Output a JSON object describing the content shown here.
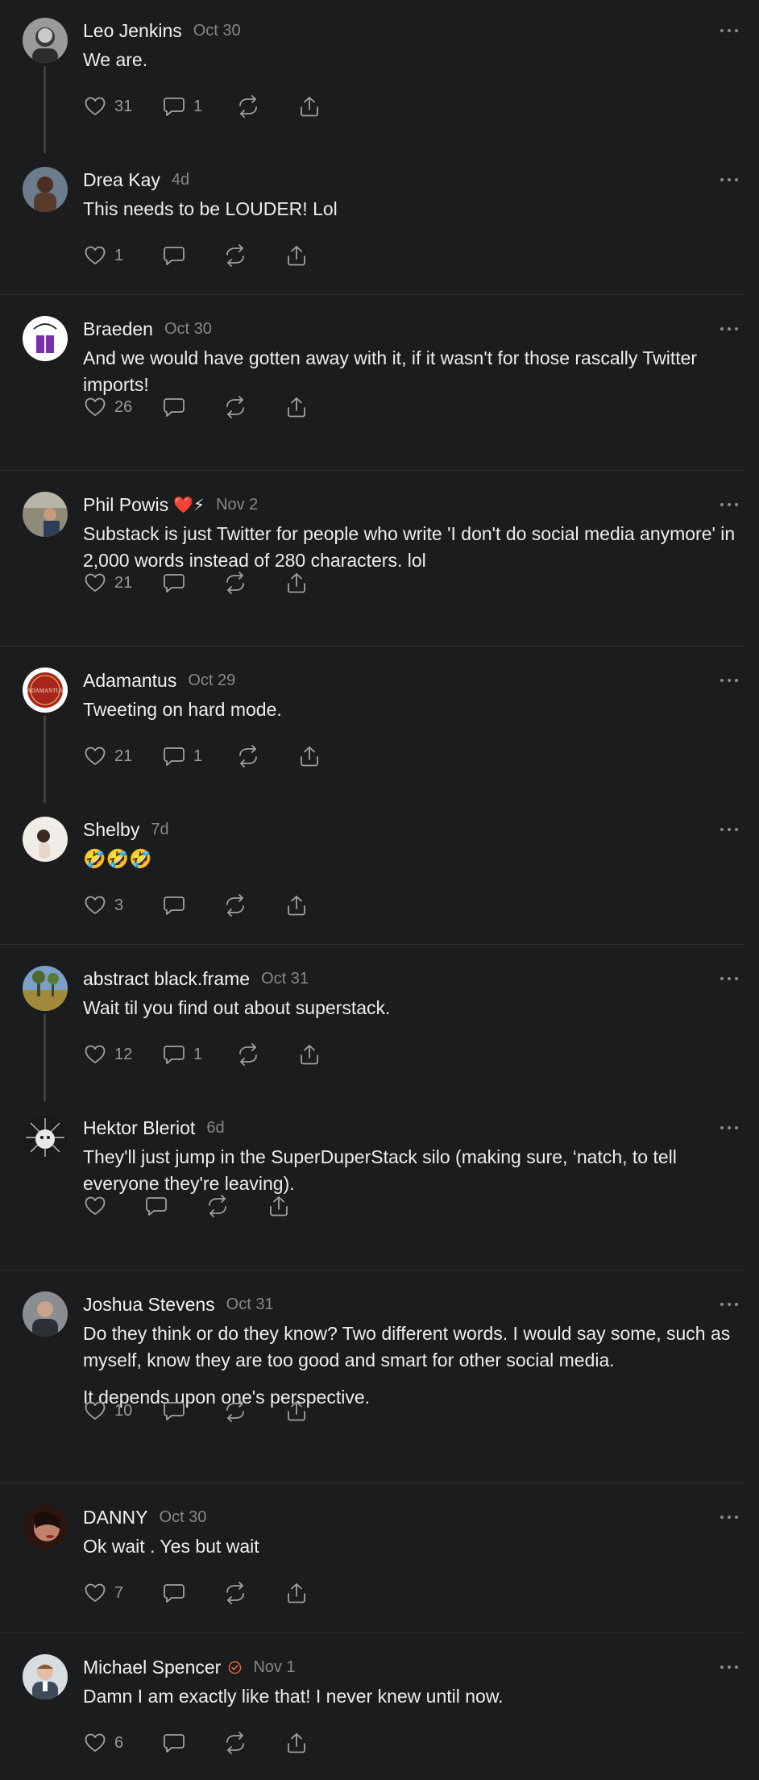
{
  "colors": {
    "background": "#1b1c1e",
    "text": "#ededed",
    "muted": "#86878a",
    "divider": "#2f3033",
    "verified": "#e8643a"
  },
  "comments": [
    {
      "name": "Leo Jenkins",
      "date": "Oct 30",
      "body": [
        "We are."
      ],
      "likes": "31",
      "replies": "1"
    },
    {
      "name": "Drea Kay",
      "date": "4d",
      "body": [
        "This needs to be LOUDER! Lol"
      ],
      "likes": "1",
      "replies": ""
    },
    {
      "name": "Braeden",
      "date": "Oct 30",
      "body": [
        "And we would have gotten away with it, if it wasn't for those rascally Twitter imports!"
      ],
      "likes": "26",
      "replies": ""
    },
    {
      "name": "Phil Powis",
      "badge": "❤️⚡",
      "date": "Nov 2",
      "body": [
        "Substack is just Twitter for people who write 'I don't do social media anymore' in 2,000 words instead of 280 characters. lol"
      ],
      "likes": "21",
      "replies": ""
    },
    {
      "name": "Adamantus",
      "date": "Oct 29",
      "body": [
        "Tweeting on hard mode."
      ],
      "likes": "21",
      "replies": "1",
      "avatar_text": "ADAMANTUS"
    },
    {
      "name": "Shelby",
      "date": "7d",
      "body": [
        "🤣🤣🤣"
      ],
      "likes": "3",
      "replies": ""
    },
    {
      "name": "abstract black.frame",
      "date": "Oct 31",
      "body": [
        "Wait til you find out about superstack."
      ],
      "likes": "12",
      "replies": "1"
    },
    {
      "name": "Hektor Bleriot",
      "date": "6d",
      "body": [
        "They'll just jump in the SuperDuperStack silo (making sure, ‘natch, to tell everyone they're leaving)."
      ],
      "likes": "",
      "replies": ""
    },
    {
      "name": "Joshua Stevens",
      "date": "Oct 31",
      "body": [
        "Do they think or do they know? Two different words. I would say some, such as myself, know they are too good and smart for other social media.",
        "It depends upon one's perspective."
      ],
      "likes": "10",
      "replies": ""
    },
    {
      "name": "DANNY",
      "date": "Oct 30",
      "body": [
        "Ok wait . Yes but wait"
      ],
      "likes": "7",
      "replies": ""
    },
    {
      "name": "Michael Spencer",
      "verified": true,
      "date": "Nov 1",
      "body": [
        "Damn I am exactly like that! I never knew until now."
      ],
      "likes": "6",
      "replies": ""
    }
  ]
}
